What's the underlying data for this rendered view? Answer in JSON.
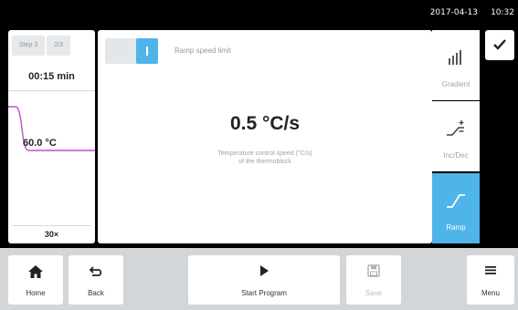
{
  "status": {
    "date": "2017-04-13",
    "time": "10:32"
  },
  "step": {
    "label": "Step 3",
    "position": "2/3",
    "duration": "00:15 min",
    "temperature": "60.0 °C",
    "cycles": "30×",
    "curve_color": "#c04fc8"
  },
  "ramp": {
    "toggle_label": "Ramp speed limit",
    "value": "0.5 °C/s",
    "description_line1": "Temperature control speed (°C/s)",
    "description_line2": "of the thermoblock"
  },
  "side_tabs": [
    {
      "label": "Gradient",
      "icon": "gradient-icon",
      "active": false
    },
    {
      "label": "Inc/Dec",
      "icon": "inc-dec-icon",
      "active": false
    },
    {
      "label": "Ramp",
      "icon": "ramp-icon",
      "active": true
    }
  ],
  "confirm": {
    "icon": "checkmark-icon"
  },
  "bottom": {
    "home": "Home",
    "back": "Back",
    "start": "Start Program",
    "save": "Save",
    "menu": "Menu"
  },
  "colors": {
    "accent": "#4fb4e8",
    "panel": "#ffffff",
    "footer": "#d3d6d9"
  }
}
